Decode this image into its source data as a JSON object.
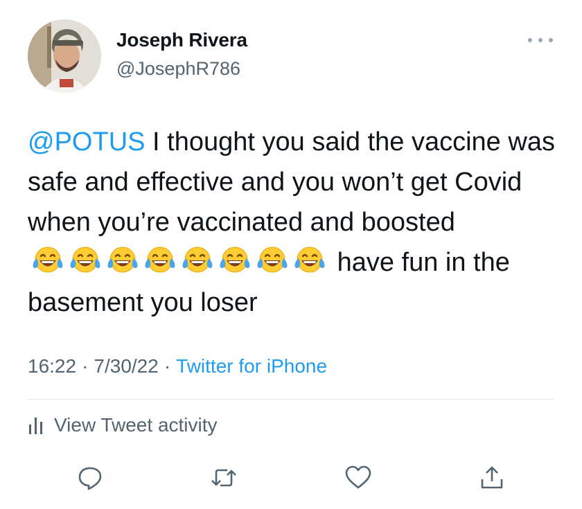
{
  "author": {
    "name": "Joseph Rivera",
    "handle": "@JosephR786"
  },
  "tweet": {
    "mention": "@POTUS",
    "text_before_emoji": " I thought you said the vaccine was safe and effective and you won’t get Covid when you’re vaccinated and boosted",
    "emoji": "face-with-tears-of-joy",
    "emoji_count": 8,
    "text_after_emoji": "have fun in the basement you loser"
  },
  "meta": {
    "time": "16:22",
    "separator": "·",
    "date": "7/30/22",
    "source": "Twitter for iPhone"
  },
  "activity": {
    "label": "View Tweet activity",
    "icon": "bar-chart-icon"
  },
  "actions": {
    "icons": [
      "reply-icon",
      "retweet-icon",
      "like-icon",
      "share-icon"
    ]
  },
  "colors": {
    "link": "#1d9bf0",
    "secondary_text": "#536471",
    "primary_text": "#0f1419",
    "divider": "#e6e9eb"
  }
}
